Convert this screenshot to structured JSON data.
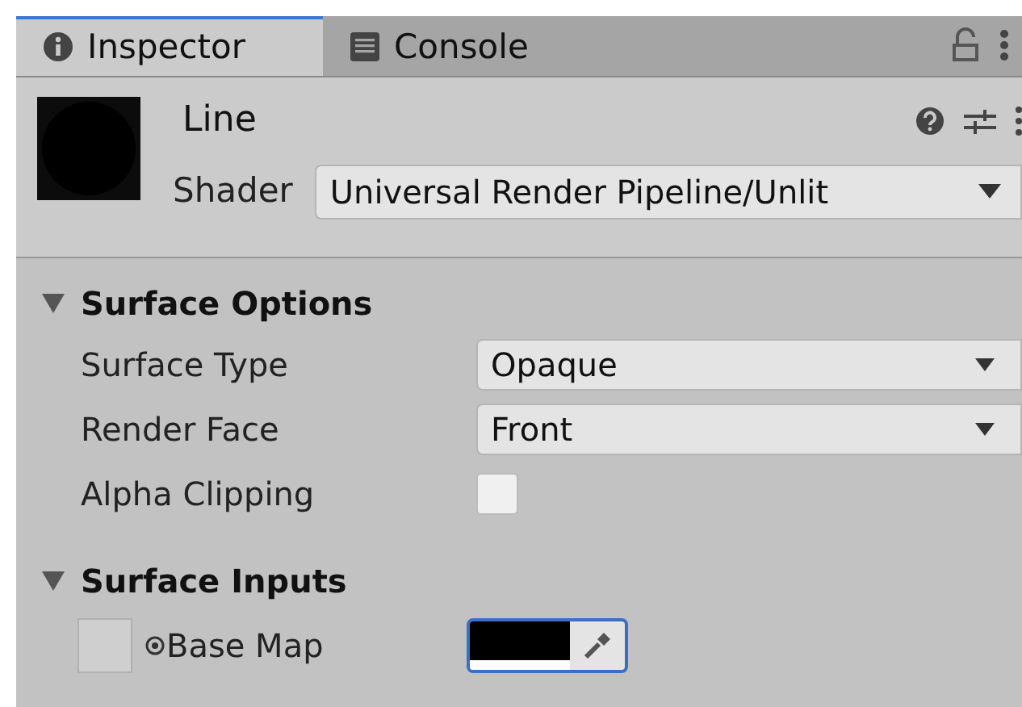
{
  "tabs": [
    {
      "label": "Inspector",
      "kind": "info",
      "selected": true
    },
    {
      "label": "Console",
      "kind": "console",
      "selected": false
    }
  ],
  "material": {
    "name": "Line",
    "shader_label": "Shader",
    "shader": "Universal Render Pipeline/Unlit"
  },
  "sections": [
    {
      "title": "Surface Options",
      "expanded": true,
      "fields": [
        {
          "kind": "dropdown",
          "label": "Surface Type",
          "value": "Opaque"
        },
        {
          "kind": "dropdown",
          "label": "Render Face",
          "value": "Front"
        },
        {
          "kind": "checkbox",
          "label": "Alpha Clipping",
          "checked": false
        }
      ]
    },
    {
      "title": "Surface Inputs",
      "expanded": true,
      "fields": [
        {
          "kind": "texture",
          "label": "Base Map",
          "color": "#000000"
        }
      ]
    }
  ]
}
